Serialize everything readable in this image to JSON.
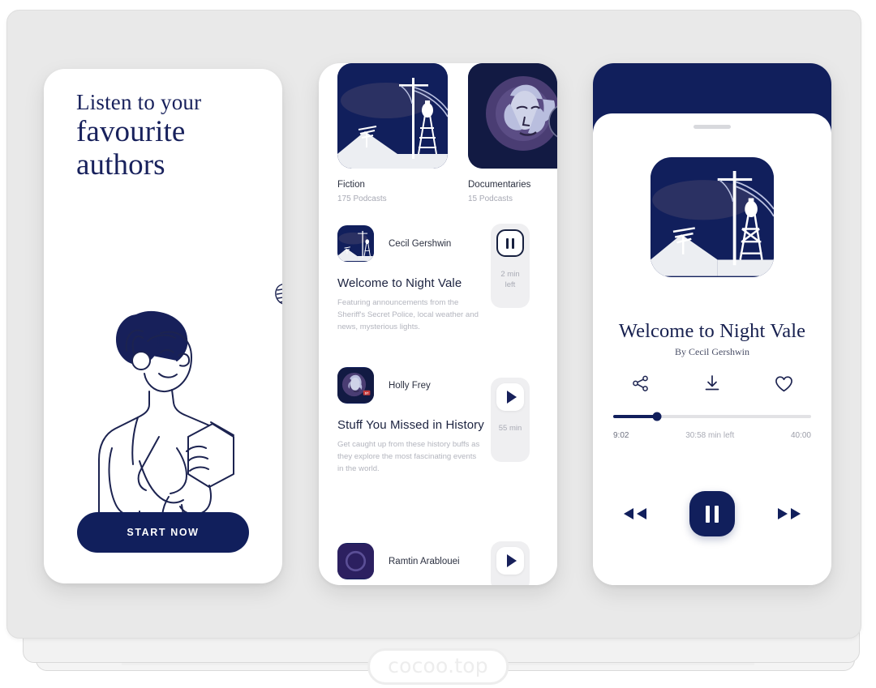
{
  "watermark": "cocoo.top",
  "colors": {
    "navy": "#111f5c",
    "background": "#e9e9e9",
    "muted": "#a9abb5",
    "card_gray": "#efeff1"
  },
  "onboarding": {
    "headline_line1": "Listen to your",
    "headline_line2": "favourite",
    "headline_line3": "authors",
    "cta_label": "START NOW",
    "mic_icon": "microphone-icon",
    "illustration": "woman-with-headphones-holding-phone"
  },
  "browse": {
    "categories": [
      {
        "name": "Fiction",
        "count": "175 Podcasts",
        "art": "night-vale-eye-moon-tower"
      },
      {
        "name": "Documentaries",
        "count": "15 Podcasts",
        "art": "portrait-purple-circle",
        "badge": "ST"
      }
    ],
    "podcasts": [
      {
        "author": "Cecil Gershwin",
        "title": "Welcome to Night Vale",
        "description": "Featuring announcements from the Sheriff's Secret Police, local weather and news, mysterious lights.",
        "action_icon": "pause-icon",
        "time_label": "2 min\nleft",
        "time_line1": "2 min",
        "time_line2": "left",
        "art": "night-vale-eye-moon-tower"
      },
      {
        "author": "Holly Frey",
        "title": "Stuff You Missed in History",
        "description": "Get caught up from these history buffs as they explore the most fascinating events in the world.",
        "action_icon": "play-icon",
        "time_line1": "55 min",
        "time_line2": "",
        "art": "portrait-purple-circle"
      },
      {
        "author": "Ramtin Arablouei",
        "title": "",
        "description": "",
        "action_icon": "play-icon",
        "time_line1": "",
        "time_line2": "",
        "art": "purple-circle-ring"
      }
    ]
  },
  "player": {
    "album_art": "night-vale-eye-moon-tower",
    "track_title": "Welcome to Night Vale",
    "track_author": "By Cecil Gershwin",
    "actions": [
      {
        "icon": "share-icon",
        "name": "share-button"
      },
      {
        "icon": "download-icon",
        "name": "download-button"
      },
      {
        "icon": "heart-icon",
        "name": "favourite-button"
      }
    ],
    "progress_percent": 22,
    "time_elapsed": "9:02",
    "time_remaining": "30:58 min left",
    "time_total": "40:00",
    "transport": {
      "rewind_icon": "rewind-icon",
      "play_state_icon": "pause-icon",
      "forward_icon": "fast-forward-icon"
    }
  }
}
